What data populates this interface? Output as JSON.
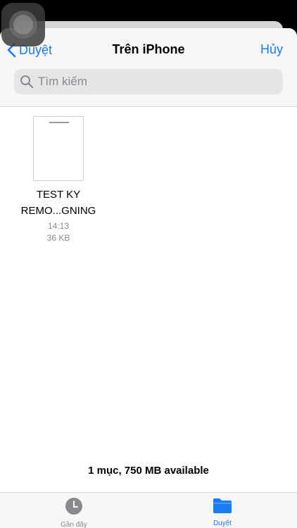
{
  "nav": {
    "back_label": "Duyệt",
    "title": "Trên iPhone",
    "cancel_label": "Hủy"
  },
  "search": {
    "placeholder": "Tìm kiếm",
    "icon": "search-icon"
  },
  "files": [
    {
      "name_line1": "TEST KY",
      "name_line2": "REMO...GNING",
      "time": "14:13",
      "size": "36 KB"
    }
  ],
  "footer": {
    "status": "1 mục, 750 MB available"
  },
  "tabs": [
    {
      "label": "Gần đây",
      "icon": "clock-icon",
      "active": false
    },
    {
      "label": "Duyệt",
      "icon": "folder-icon",
      "active": true
    }
  ],
  "colors": {
    "accent": "#1a7cf5",
    "secondary_text": "#8a8a8e"
  }
}
